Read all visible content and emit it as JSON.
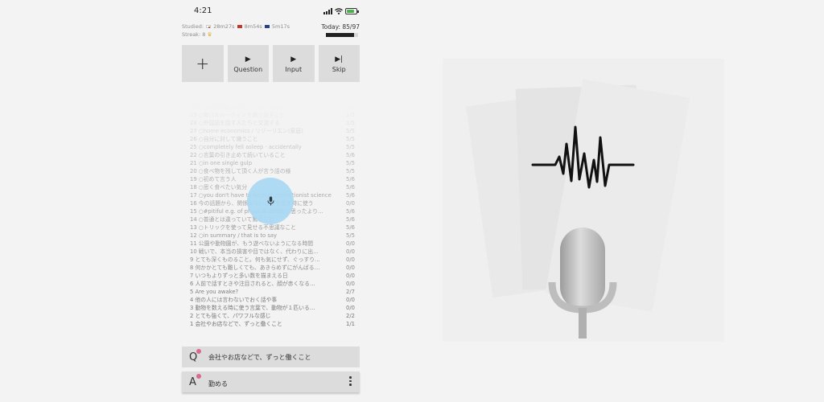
{
  "status_bar": {
    "time": "4:21",
    "battery_fraction": 0.85,
    "colors": {
      "battery": "#4caf50"
    }
  },
  "stats": {
    "studied_label": "Studied:",
    "studied_times": [
      "28m27s",
      "8m54s",
      "5m17s"
    ],
    "streak": "Streak: 8",
    "today": "Today: 85/97",
    "today_progress": 0.876
  },
  "toolbar": {
    "add_icon": "+",
    "question_label": "Question",
    "input_label": "Input",
    "skip_label": "Skip"
  },
  "cards": [
    {
      "text": "30 ○○なのが表立ちゃう / 背けるさま",
      "score": "1/5"
    },
    {
      "text": "29 ○毎日のルーティンを繰り返すこと",
      "score": "1/5"
    },
    {
      "text": "28 ○外国語を話す人たちと交流する",
      "score": "1/5"
    },
    {
      "text": "27 ○home economics / リゾーリエン(家庭)",
      "score": "5/5"
    },
    {
      "text": "26 ○自分に対して嫌うこと",
      "score": "5/5"
    },
    {
      "text": "25 ○completely fell asleep · accidentally",
      "score": "5/5"
    },
    {
      "text": "22 ○言葉の引き止めて続いていること",
      "score": "5/6"
    },
    {
      "text": "21 ○in one single gulp",
      "score": "5/5"
    },
    {
      "text": "20 ○食べ物を残して頂く人が言う話の様",
      "score": "5/5"
    },
    {
      "text": "19 ○初めて言う人",
      "score": "5/6"
    },
    {
      "text": "18 ○思く食べたい気分",
      "score": "5/6"
    },
    {
      "text": "17 ○you don't have to be that perfectionist science",
      "score": "5/6"
    },
    {
      "text": "16 今の話題から、関係のないことを話す時に使う",
      "score": "0/0"
    },
    {
      "text": "15 ○#pitiful e.g. of physical ability / 思ったより…",
      "score": "5/6"
    },
    {
      "text": "14 ○普通とは違っていて驚くこと",
      "score": "5/6"
    },
    {
      "text": "13 ○トリックを使って見せる不思議なこと",
      "score": "5/6"
    },
    {
      "text": "12 ○in summary / that is to say",
      "score": "5/5"
    },
    {
      "text": "11 公園や動物園が、もう遊べないようになる時間",
      "score": "0/0"
    },
    {
      "text": "10 戦いで、本当の損害や目ではなく、代わりに出…",
      "score": "0/0"
    },
    {
      "text": "9 とても深くものること。何も気にせず、ぐっすり…",
      "score": "0/0"
    },
    {
      "text": "8 何かかとても難しくても、あきらめずにがんばる…",
      "score": "0/0"
    },
    {
      "text": "7 いつもよりずっと多い数を描まえる日",
      "score": "0/0"
    },
    {
      "text": "6 人前で話すときや注目されると、顔が赤くなる…",
      "score": "0/0"
    },
    {
      "text": "5 Are you awake?",
      "score": "2/7"
    },
    {
      "text": "4 他の人には言わないでおく話や事",
      "score": "0/0"
    },
    {
      "text": "3 動物を数える時に使う言葉で、動物が１匹いる…",
      "score": "0/0"
    },
    {
      "text": "2 とても強くて、パワフルな感じ",
      "score": "2/2"
    },
    {
      "text": "1 会社やお店などで、ずっと働くこと",
      "score": "1/1"
    }
  ],
  "question": {
    "letter": "Q",
    "text": "会社やお店などで、ずっと働くこと"
  },
  "answer": {
    "letter": "A",
    "text": "勤める"
  },
  "colors": {
    "background": "#f4f3f3",
    "button_bg": "#dcdcdc",
    "mic_fab": "#a9d8f5",
    "accent_dot": "#d86a8c",
    "crown": "#e0b84a"
  }
}
